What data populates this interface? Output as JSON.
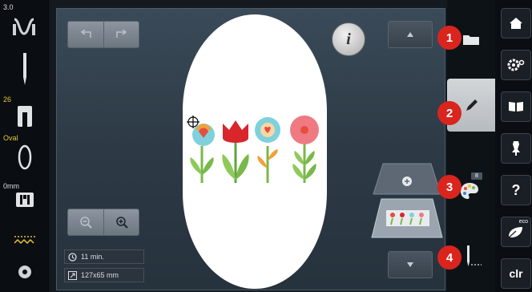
{
  "left_bar": {
    "tension_value": "3.0",
    "presser_value": "26",
    "hoop_label": "Oval",
    "stitch_length_value": "0mm"
  },
  "toolbar": {
    "info_label": "i"
  },
  "info": {
    "time": "11 min.",
    "size": "127x65 mm"
  },
  "badges": {
    "b1": "1",
    "b2": "2",
    "b3": "3",
    "b4": "4"
  },
  "color_count": "8",
  "right_bar": {
    "eco_label": "eco",
    "clr_label": "clr",
    "help_label": "?"
  }
}
